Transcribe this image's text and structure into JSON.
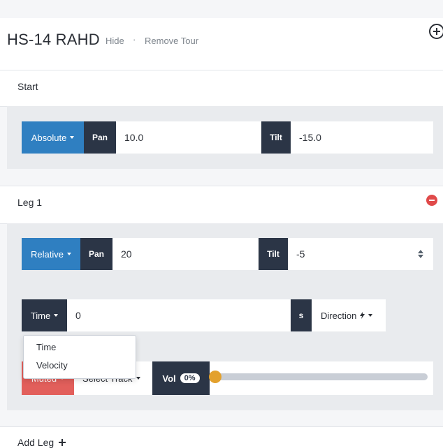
{
  "tour": {
    "title": "HS-14 RAHD",
    "hide_label": "Hide",
    "separator": "·",
    "remove_label": "Remove Tour",
    "add_icon": "plus-circle-icon"
  },
  "start": {
    "label": "Start",
    "mode": "Absolute",
    "pan_label": "Pan",
    "pan_value": "10.0",
    "tilt_label": "Tilt",
    "tilt_value": "-15.0"
  },
  "leg1": {
    "label": "Leg 1",
    "remove_icon": "minus-circle-icon",
    "mode": "Relative",
    "pan_label": "Pan",
    "pan_value": "20",
    "tilt_label": "Tilt",
    "tilt_value": "-5",
    "time_mode": "Time",
    "time_value": "0",
    "time_unit": "s",
    "direction_label": "Direction",
    "direction_icon": "bolt-icon",
    "dropdown_options": [
      "Time",
      "Velocity"
    ],
    "muted_label": "Muted",
    "track_label": "Select Track",
    "vol_label": "Vol",
    "vol_value": "0%",
    "vol_level": 0
  },
  "add_leg_label": "Add Leg",
  "colors": {
    "blue": "#2f7fc1",
    "dark": "#2b3546",
    "muted_red": "#e25f5b",
    "remove_red": "#e04a4a",
    "knob": "#e3a12d"
  }
}
